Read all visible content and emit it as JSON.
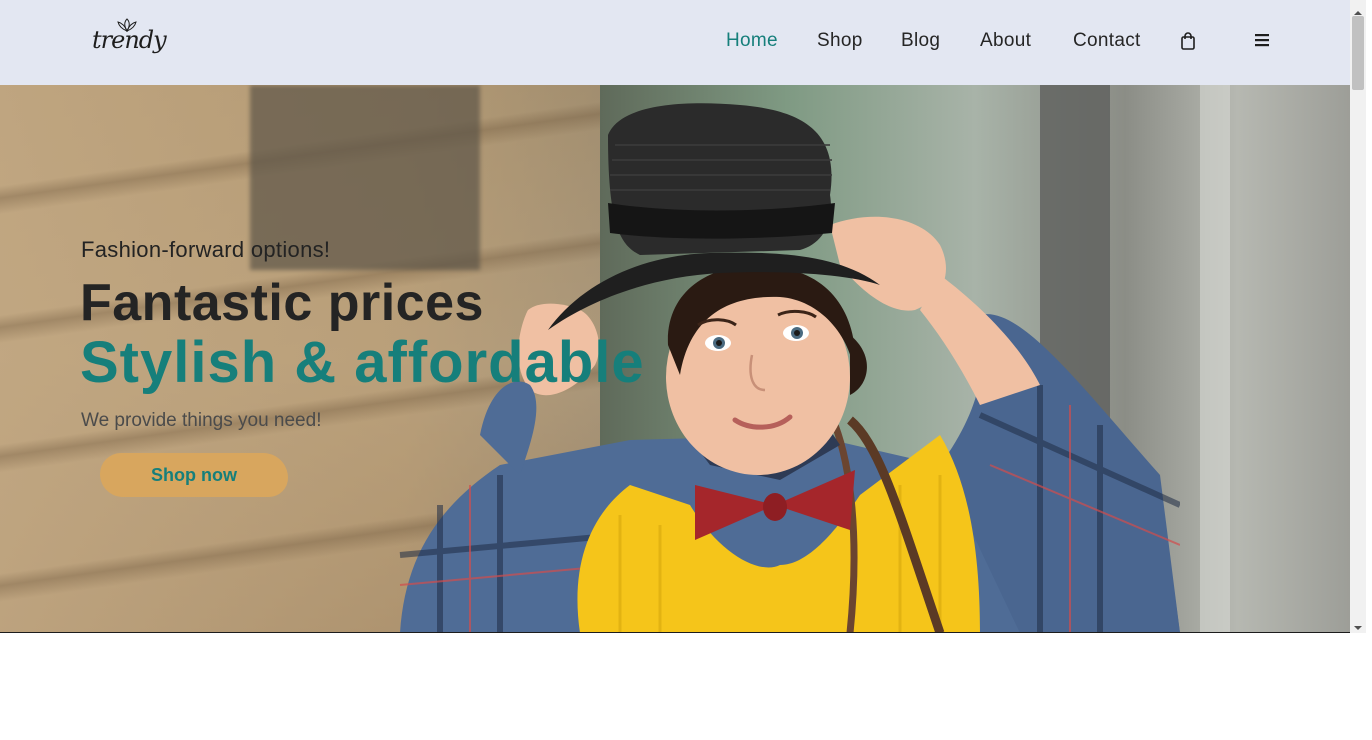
{
  "header": {
    "logo_text": "trendy",
    "nav": [
      {
        "label": "Home",
        "active": true
      },
      {
        "label": "Shop",
        "active": false
      },
      {
        "label": "Blog",
        "active": false
      },
      {
        "label": "About",
        "active": false
      },
      {
        "label": "Contact",
        "active": false
      }
    ],
    "icons": [
      "shopping-bag-icon",
      "hamburger-menu-icon"
    ]
  },
  "hero": {
    "subtitle": "Fashion-forward options!",
    "title": "Fantastic prices",
    "title_accent": "Stylish & affordable",
    "description": "We provide things you need!",
    "cta_label": "Shop now"
  },
  "colors": {
    "accent": "#167f7b",
    "nav_bg": "#e3e7f2",
    "cta_bg": "#d8a65e",
    "text_dark": "#242424"
  }
}
